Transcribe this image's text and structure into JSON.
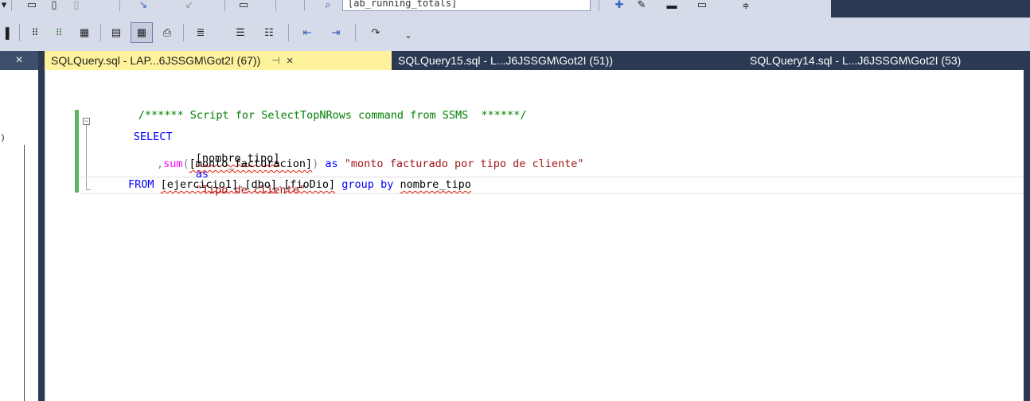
{
  "toolbar": {
    "db_combo_value": "[ab_running_totals]",
    "icons_row1": [
      "database-icon",
      "page-icon",
      "page-icon",
      "redo-arrow-icon",
      "undo-arrow-icon",
      "query-icon",
      "search-icon",
      "add-icon",
      "pen-icon",
      "window-icon",
      "window-icon",
      "overflow-icon"
    ],
    "icons_row2": [
      "results-to-text-icon",
      "show-plan-icon",
      "estimated-plan-icon",
      "client-stats-icon",
      "results-to-grid-icon",
      "results-file-icon",
      "parse-icon",
      "comment-icon",
      "uncomment-icon",
      "outdent-icon",
      "indent-icon",
      "specify-values-icon",
      "overflow-icon"
    ]
  },
  "tabs": {
    "left_close_label": "×",
    "active": {
      "label": "SQLQuery.sql - LAP...6JSSGM\\Got2I (67))",
      "pin": "⊣",
      "close": "×"
    },
    "tab2": {
      "label": "SQLQuery15.sql - L...J6JSSGM\\Got2I (51))"
    },
    "tab3": {
      "label": "SQLQuery14.sql - L...J6JSSGM\\Got2I (53)"
    }
  },
  "editor": {
    "line1": "/****** Script for SelectTopNRows command from SSMS  ******/",
    "line2_kw": "SELECT",
    "line3_ident": "[nombre_tipo]",
    "line3_as": "as",
    "line3_str": "\"Tipo de cliente\"",
    "line4_comma": ",",
    "line4_fn": "sum",
    "line4_open": "(",
    "line4_ident": "[monto_facturacion]",
    "line4_close": ")",
    "line4_as": "as",
    "line4_str": "\"monto facturado por tipo de cliente\"",
    "line5_from": "FROM",
    "line5_db": "[ejercicio1]",
    "line5_dot1": ".",
    "line5_schema": "[dbo]",
    "line5_dot2": ".",
    "line5_table": "[fioDio]",
    "line5_group": "group by",
    "line5_col": "nombre_tipo"
  },
  "colors": {
    "keyword": "#0000ff",
    "function": "#ff00ff",
    "string": "#a31515",
    "comment": "#008000",
    "active_tab": "#fff29d",
    "chrome": "#2b3a52"
  }
}
